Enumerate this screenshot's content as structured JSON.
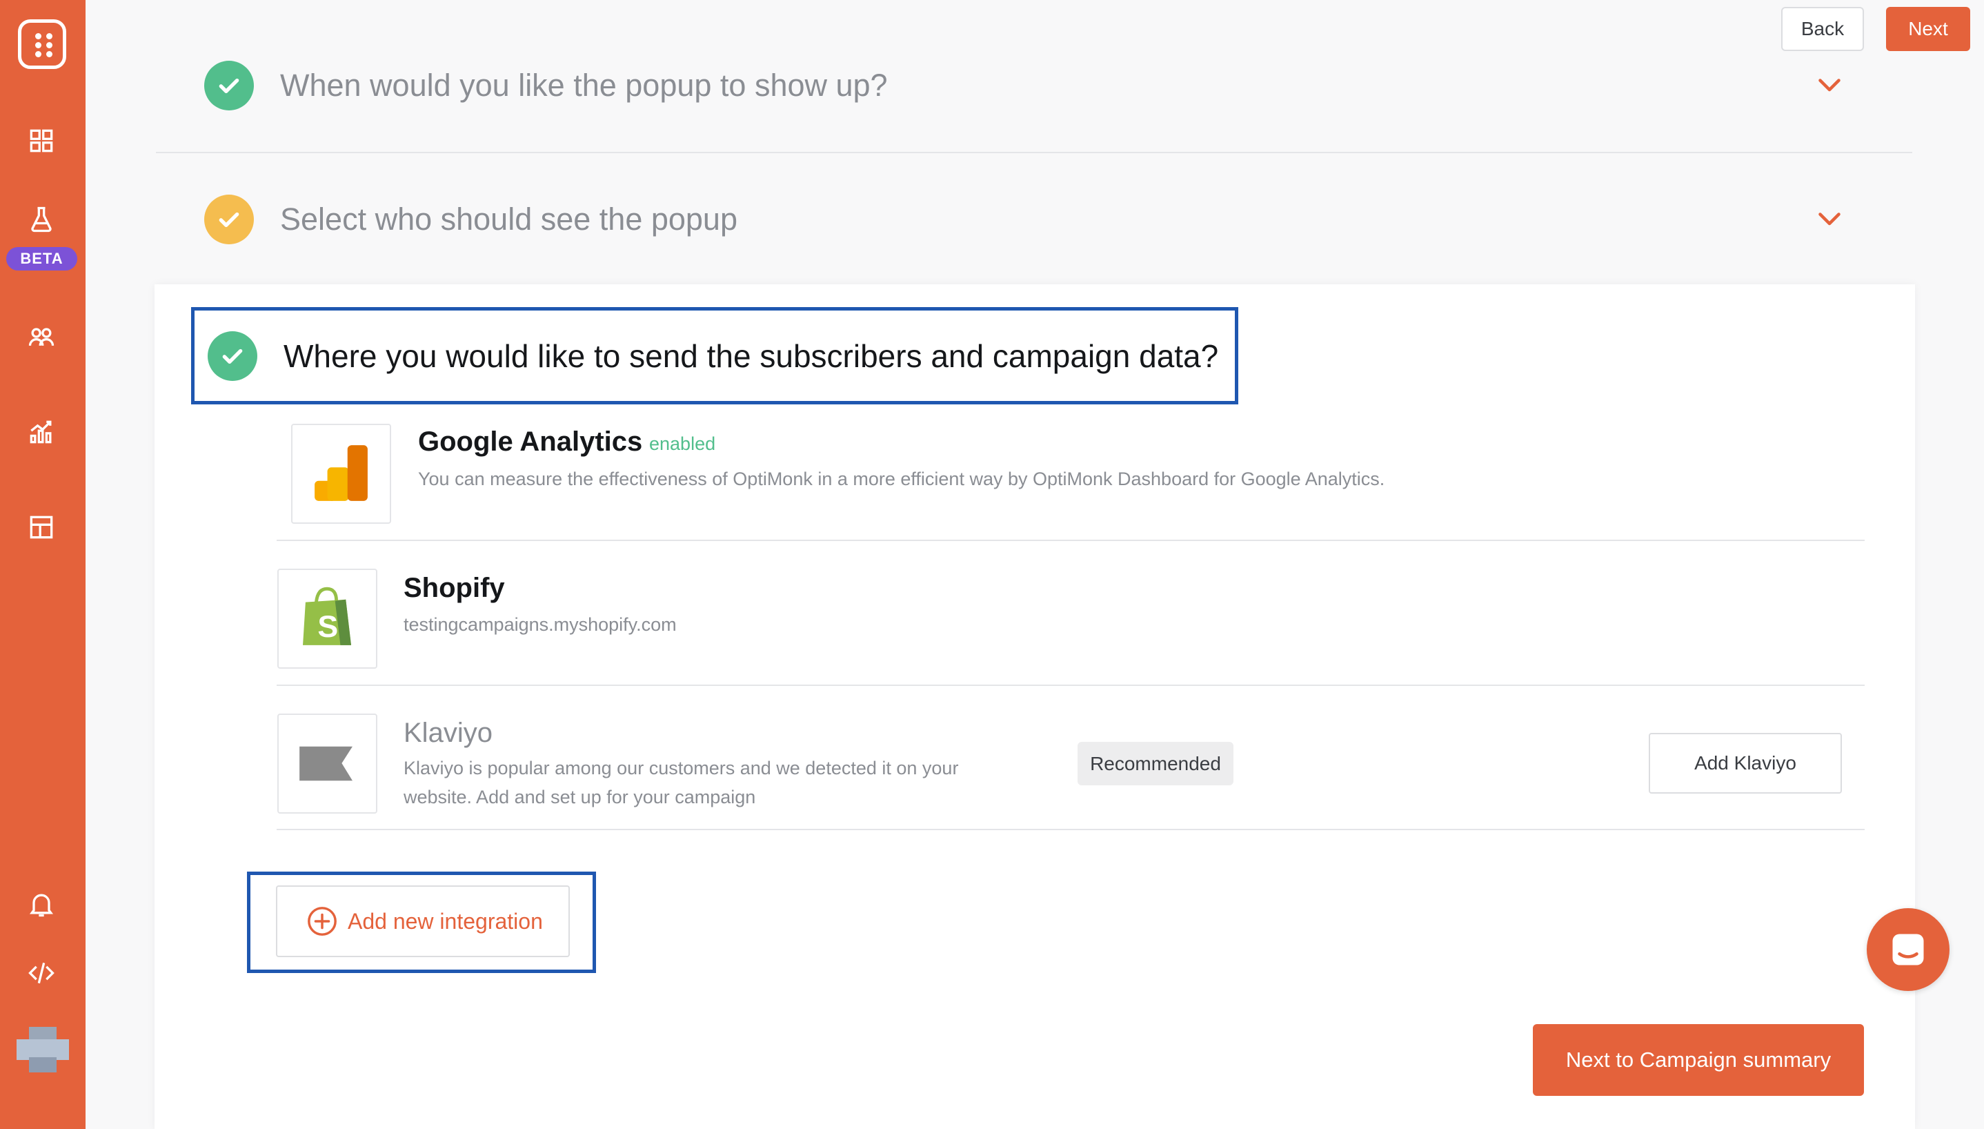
{
  "sidebar": {
    "logo": "optimonk-logo",
    "items": [
      {
        "name": "dashboard",
        "icon": "grid-icon"
      },
      {
        "name": "experiments",
        "icon": "flask-icon",
        "badge": "BETA"
      },
      {
        "name": "subscribers",
        "icon": "users-icon"
      },
      {
        "name": "analytics",
        "icon": "chart-icon"
      },
      {
        "name": "templates",
        "icon": "layout-icon"
      }
    ],
    "bottom": [
      {
        "name": "notifications",
        "icon": "bell-icon"
      },
      {
        "name": "code",
        "icon": "code-icon"
      },
      {
        "name": "account",
        "icon": "avatar"
      }
    ]
  },
  "header": {
    "back_label": "Back",
    "next_label": "Next"
  },
  "sections": [
    {
      "title": "When would you like the popup to show up?",
      "status": "complete"
    },
    {
      "title": "Select who should see the popup",
      "status": "warning"
    },
    {
      "title": "Where you would like to send the subscribers and campaign data?",
      "status": "complete"
    }
  ],
  "integrations": [
    {
      "name": "Google Analytics",
      "status": "enabled",
      "description": "You can measure the effectiveness of OptiMonk in a more efficient way by OptiMonk Dashboard for Google Analytics."
    },
    {
      "name": "Shopify",
      "description": "testingcampaigns.myshopify.com"
    },
    {
      "name": "Klaviyo",
      "description_line1": "Klaviyo is popular among our customers and we detected it on your",
      "description_line2": "website. Add and set up for your campaign",
      "badge": "Recommended",
      "action_label": "Add Klaviyo"
    }
  ],
  "add_integration_label": "Add new integration",
  "next_summary_label": "Next to Campaign summary",
  "colors": {
    "brand": "#e4623b",
    "success": "#52be8c",
    "warning": "#f5bd4f",
    "beta": "#7c52d7",
    "highlight": "#1f57b0"
  }
}
